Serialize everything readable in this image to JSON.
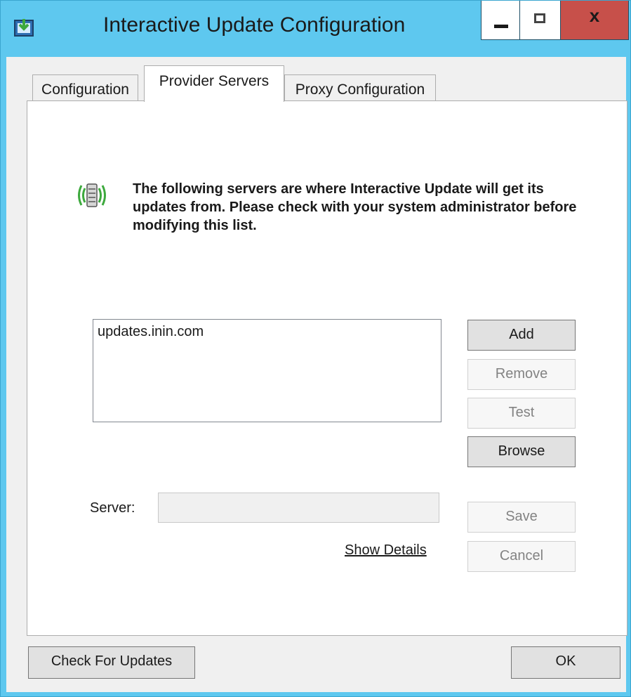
{
  "window": {
    "title": "Interactive Update Configuration",
    "close_glyph": "x"
  },
  "tabs": [
    {
      "label": "Configuration",
      "active": false
    },
    {
      "label": "Provider Servers",
      "active": true
    },
    {
      "label": "Proxy Configuration",
      "active": false
    }
  ],
  "info": {
    "icon": "server-signal-icon",
    "text": "The following servers are where Interactive Update will get its updates from.  Please check with your system administrator before modifying this list."
  },
  "server_list": {
    "items": [
      "updates.inin.com"
    ]
  },
  "buttons": {
    "add": "Add",
    "remove": "Remove",
    "test": "Test",
    "browse": "Browse",
    "save": "Save",
    "cancel": "Cancel",
    "check_updates": "Check For Updates",
    "ok": "OK"
  },
  "server_field": {
    "label": "Server:",
    "value": ""
  },
  "show_details": "Show Details",
  "colors": {
    "titlebar": "#5ec8ef",
    "close_button": "#c7504a",
    "icon_green": "#3da93d"
  }
}
